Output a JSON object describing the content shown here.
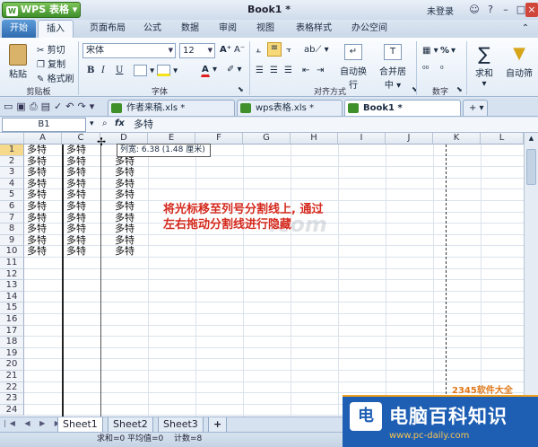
{
  "app": {
    "name": "WPS 表格",
    "doc_title": "Book1 *",
    "login": "未登录"
  },
  "ribbon_tabs": [
    "开始",
    "插入",
    "页面布局",
    "公式",
    "数据",
    "审阅",
    "视图",
    "表格样式",
    "办公空间"
  ],
  "ribbon": {
    "paste": "粘贴",
    "cut": "剪切",
    "copy": "复制",
    "format_painter": "格式刷",
    "clipboard_group": "剪贴板",
    "font_name": "宋体",
    "font_size": "12",
    "font_group": "字体",
    "bold": "B",
    "italic": "I",
    "underline": "U",
    "font_color": "A",
    "wrap": "自动换行",
    "merge": "合并居中",
    "align_group": "对齐方式",
    "percent": "%",
    "number_group": "数字",
    "sum": "求和",
    "filter": "自动筛"
  },
  "doc_tabs": [
    {
      "label": "作者来稿.xls *"
    },
    {
      "label": "wps表格.xls *"
    },
    {
      "label": "Book1 *"
    }
  ],
  "formula_bar": {
    "cell_ref": "B1",
    "fx": "fx",
    "content": "多特"
  },
  "columns": [
    "A",
    "C",
    "D",
    "E",
    "F",
    "G",
    "H",
    "I",
    "J",
    "K",
    "L"
  ],
  "rows": [
    "1",
    "2",
    "3",
    "4",
    "5",
    "6",
    "7",
    "8",
    "9",
    "10",
    "11",
    "12",
    "13",
    "14",
    "15",
    "16",
    "17",
    "18",
    "19",
    "20",
    "21",
    "22",
    "23",
    "24"
  ],
  "cell_text": "多特",
  "tooltip": "列宽: 6.38 (1.48 厘米)",
  "annotation": [
    "将光标移至列号分割线上, 通过",
    "左右拖动分割线进行隐藏"
  ],
  "watermark": ".com",
  "sheets": [
    "Sheet1",
    "Sheet2",
    "Sheet3"
  ],
  "add_sheet": "+",
  "status": {
    "sum": "求和=0",
    "avg": "平均值=0",
    "count": "计数=8"
  },
  "logo": {
    "mark": "电",
    "title": "电脑百科知识",
    "url": "www.pc-daily.com",
    "secondary": "2345软件大全"
  }
}
